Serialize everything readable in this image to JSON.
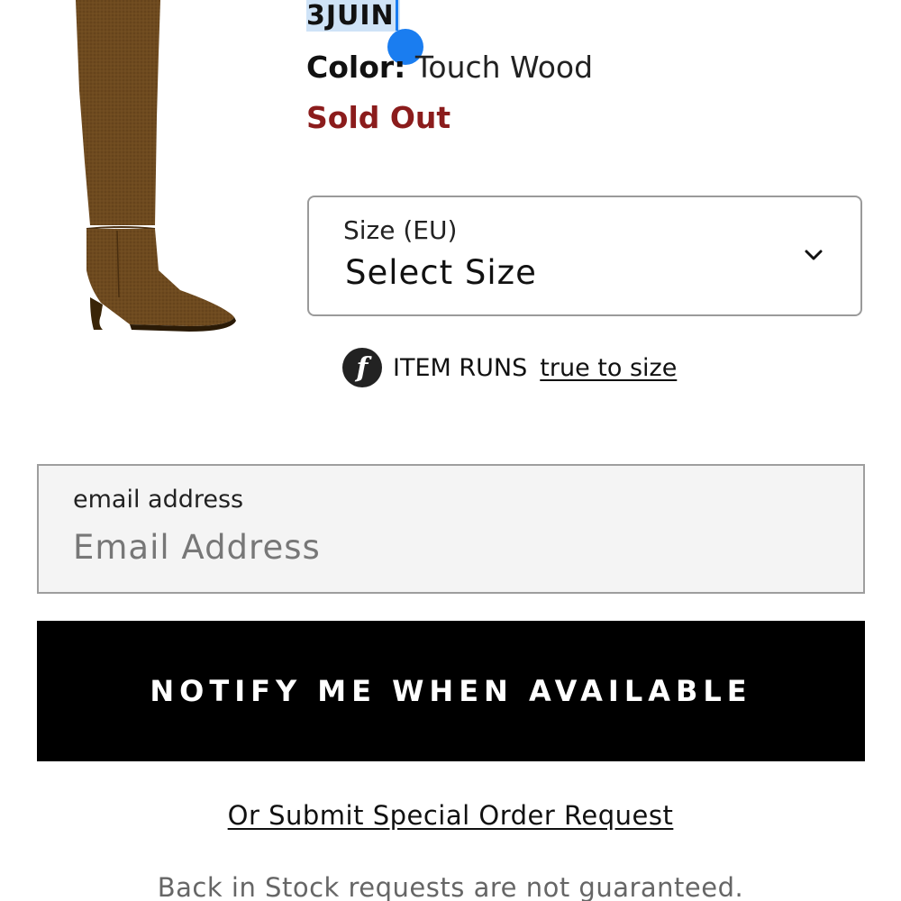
{
  "product": {
    "brand": "3JUIN",
    "color_label": "Color:",
    "color_value": "Touch Wood",
    "status": "Sold Out"
  },
  "size_select": {
    "label": "Size (EU)",
    "value": "Select Size"
  },
  "fit": {
    "icon_glyph": "f",
    "text": "ITEM RUNS",
    "link": "true to size"
  },
  "email": {
    "label": "email address",
    "placeholder": "Email Address"
  },
  "notify_button": {
    "label": "NOTIFY ME WHEN AVAILABLE"
  },
  "special_order": {
    "label": "Or Submit Special Order Request"
  },
  "disclaimer": {
    "text": "Back in Stock requests are not guaranteed."
  },
  "colors": {
    "sold_out": "#8b1c1c",
    "selection_highlight": "#cfe3f7",
    "selection_handle": "#1a7df0",
    "button_bg": "#000000",
    "field_bg": "#f4f4f4"
  }
}
